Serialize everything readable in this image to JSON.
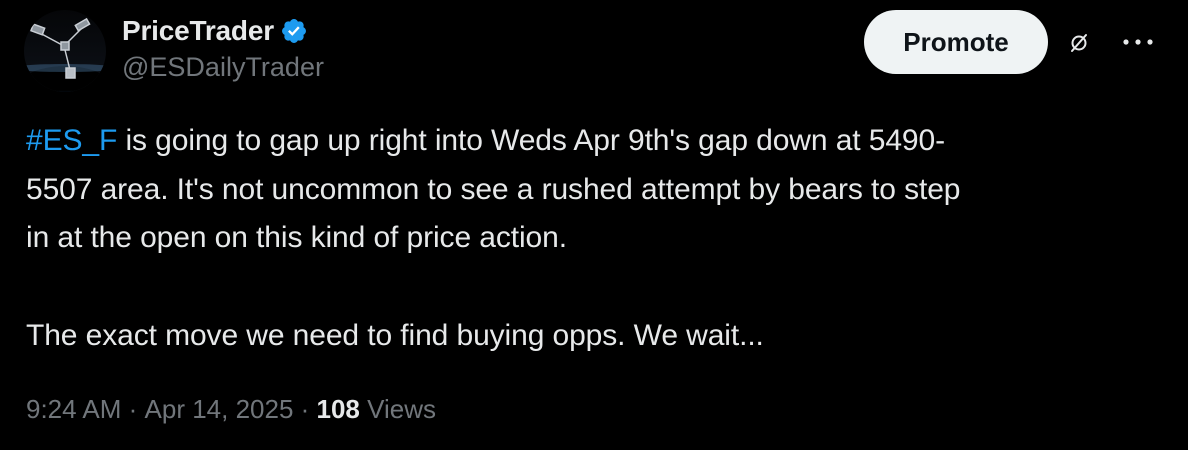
{
  "author": {
    "display_name": "PriceTrader",
    "handle": "@ESDailyTrader",
    "verified": true,
    "verified_color": "#1d9bf0",
    "avatar_icon": "satellite-in-orbit-avatar"
  },
  "header": {
    "promote_label": "Promote",
    "grok_icon": "grok-icon",
    "more_icon": "more-horizontal-icon"
  },
  "tweet": {
    "hashtag": "#ES_F",
    "para1_rest": " is going to gap up right into Weds Apr 9th's gap down at 5490-\n5507 area. It's not uncommon to see a rushed attempt by bears to step\nin at the open on this kind of price action.",
    "para2": "The exact move we need to find buying opps. We wait..."
  },
  "meta": {
    "time": "9:24 AM",
    "separator1": " · ",
    "date": "Apr 14, 2025",
    "separator2": " · ",
    "views_count": "108",
    "views_label": " Views"
  },
  "colors": {
    "background": "#000000",
    "text": "#e7e9ea",
    "secondary": "#71767b",
    "link": "#1d9bf0",
    "button_bg": "#eff3f4"
  }
}
